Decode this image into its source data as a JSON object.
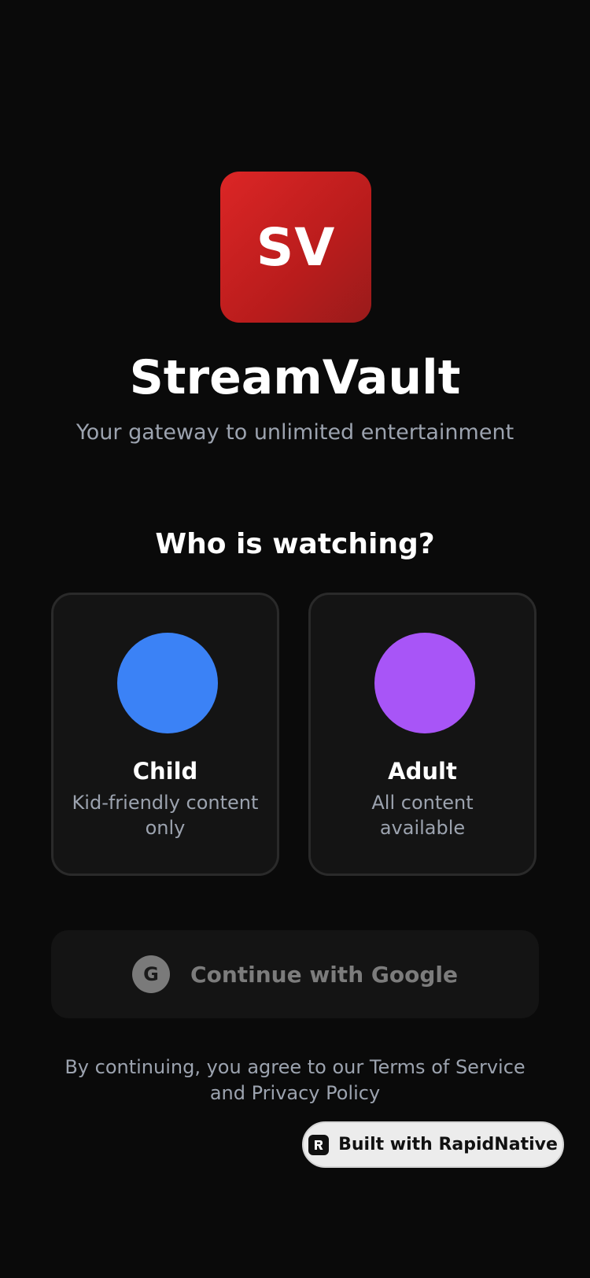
{
  "app": {
    "logo_text": "SV",
    "name": "StreamVault",
    "tagline": "Your gateway to unlimited entertainment"
  },
  "profile_section": {
    "title": "Who is watching?",
    "profiles": [
      {
        "name": "Child",
        "description": "Kid-friendly content only",
        "color": "#3b82f6"
      },
      {
        "name": "Adult",
        "description": "All content available",
        "color": "#a855f7"
      }
    ]
  },
  "google_button": {
    "icon_letter": "G",
    "label": "Continue with Google"
  },
  "legal": {
    "text": "By continuing, you agree to our Terms of Service and Privacy Policy"
  },
  "badge": {
    "icon": "rapidnative-logo-icon",
    "label": "Built with RapidNative"
  },
  "colors": {
    "background": "#0a0a0a",
    "brand_red": "#dc2626",
    "card_background": "#141414",
    "muted_text": "#9ca3af"
  }
}
